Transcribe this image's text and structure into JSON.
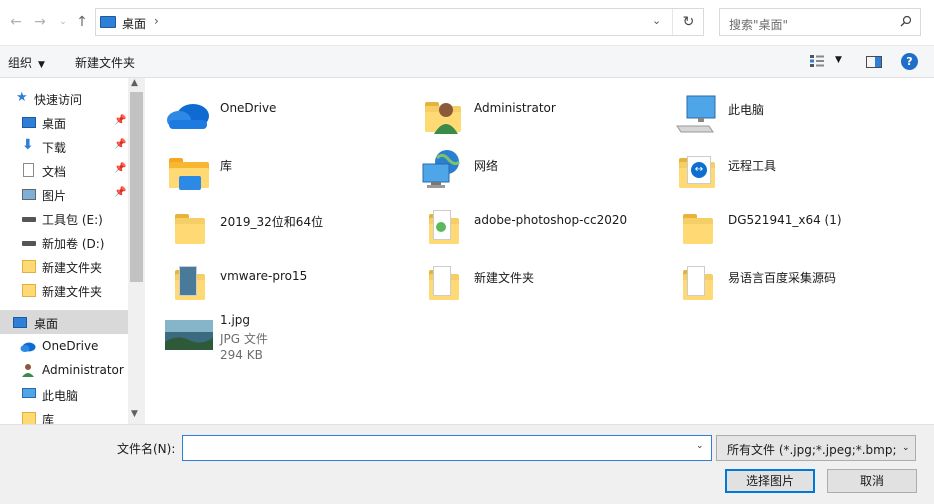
{
  "address": {
    "path": "桌面",
    "search_placeholder": "搜索\"桌面\""
  },
  "toolbar": {
    "organize": "组织",
    "new_folder": "新建文件夹",
    "help": "?"
  },
  "sidebar": {
    "items": [
      {
        "label": "快速访问",
        "icon": "star-icon",
        "pinned": false
      },
      {
        "label": "桌面",
        "icon": "desktop-icon",
        "pinned": true
      },
      {
        "label": "下载",
        "icon": "download-icon",
        "pinned": true
      },
      {
        "label": "文档",
        "icon": "document-icon",
        "pinned": true
      },
      {
        "label": "图片",
        "icon": "picture-icon",
        "pinned": true
      },
      {
        "label": "工具包 (E:)",
        "icon": "drive-icon",
        "pinned": false
      },
      {
        "label": "新加卷 (D:)",
        "icon": "drive-icon",
        "pinned": false
      },
      {
        "label": "新建文件夹",
        "icon": "folder-icon",
        "pinned": false
      },
      {
        "label": "新建文件夹",
        "icon": "folder-icon",
        "pinned": false
      },
      {
        "label": "桌面",
        "icon": "desktop-icon",
        "pinned": false
      },
      {
        "label": "OneDrive",
        "icon": "cloud-icon",
        "pinned": false
      },
      {
        "label": "Administrator",
        "icon": "user-icon",
        "pinned": false
      },
      {
        "label": "此电脑",
        "icon": "computer-icon",
        "pinned": false
      },
      {
        "label": "库",
        "icon": "library-icon",
        "pinned": false
      }
    ]
  },
  "files": [
    {
      "name": "OneDrive",
      "icon": "cloud-icon"
    },
    {
      "name": "Administrator",
      "icon": "user-folder-icon"
    },
    {
      "name": "此电脑",
      "icon": "computer-icon"
    },
    {
      "name": "库",
      "icon": "library-icon"
    },
    {
      "name": "网络",
      "icon": "network-icon"
    },
    {
      "name": "远程工具",
      "icon": "teamviewer-folder-icon"
    },
    {
      "name": "2019_32位和64位",
      "icon": "folder-icon"
    },
    {
      "name": "adobe-photoshop-cc2020",
      "icon": "folder-icon"
    },
    {
      "name": "DG521941_x64 (1)",
      "icon": "folder-icon"
    },
    {
      "name": "vmware-pro15",
      "icon": "folder-icon"
    },
    {
      "name": "新建文件夹",
      "icon": "folder-icon"
    },
    {
      "name": "易语言百度采集源码",
      "icon": "folder-icon"
    },
    {
      "name": "1.jpg",
      "icon": "image-file-icon",
      "type": "JPG 文件",
      "size": "294 KB"
    }
  ],
  "bottom": {
    "filename_label": "文件名(N):",
    "filename_value": "",
    "filter_text": "所有文件 (*.jpg;*.jpeg;*.bmp;*.",
    "open_button": "选择图片",
    "cancel_button": "取消"
  },
  "colors": {
    "accent": "#0078d7",
    "folder": "#f5cf66",
    "selection": "#d9d9d9"
  }
}
